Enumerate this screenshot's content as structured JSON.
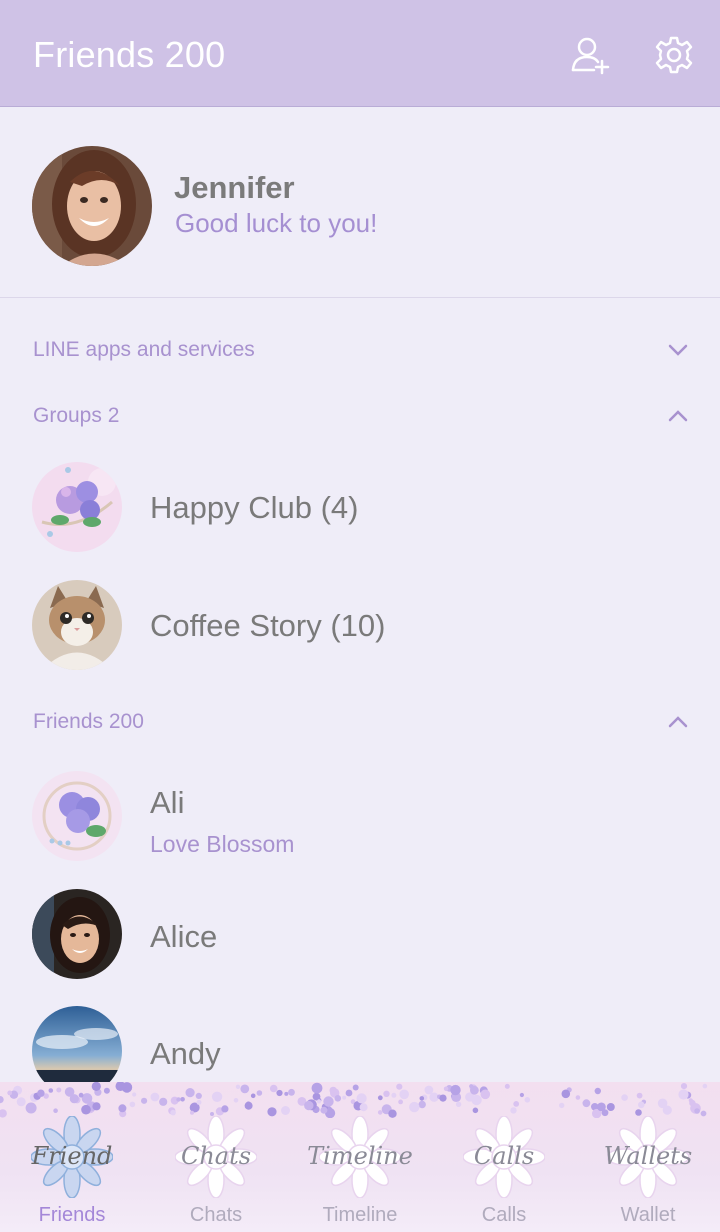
{
  "header": {
    "title": "Friends 200",
    "add_friend_icon": "add-friend-icon",
    "settings_icon": "gear-icon"
  },
  "profile": {
    "name": "Jennifer",
    "status": "Good luck to you!"
  },
  "sections": {
    "services": {
      "label": "LINE apps and services",
      "expanded": false
    },
    "groups": {
      "label": "Groups 2",
      "expanded": true
    },
    "friends": {
      "label": "Friends 200",
      "expanded": true
    }
  },
  "groups": [
    {
      "name": "Happy Club (4)"
    },
    {
      "name": "Coffee Story (10)"
    }
  ],
  "friends": [
    {
      "name": "Ali",
      "status": "Love Blossom"
    },
    {
      "name": "Alice",
      "status": ""
    },
    {
      "name": "Andy",
      "status": ""
    }
  ],
  "tabs": [
    {
      "script": "Friend",
      "label": "Friends",
      "active": true
    },
    {
      "script": "Chats",
      "label": "Chats",
      "active": false
    },
    {
      "script": "Timeline",
      "label": "Timeline",
      "active": false
    },
    {
      "script": "Calls",
      "label": "Calls",
      "active": false
    },
    {
      "script": "Wallets",
      "label": "Wallet",
      "active": false
    }
  ],
  "colors": {
    "header_bg": "#cfc2e6",
    "page_bg": "#efedf8",
    "accent": "#a892cf",
    "text": "#7a7a7a"
  }
}
